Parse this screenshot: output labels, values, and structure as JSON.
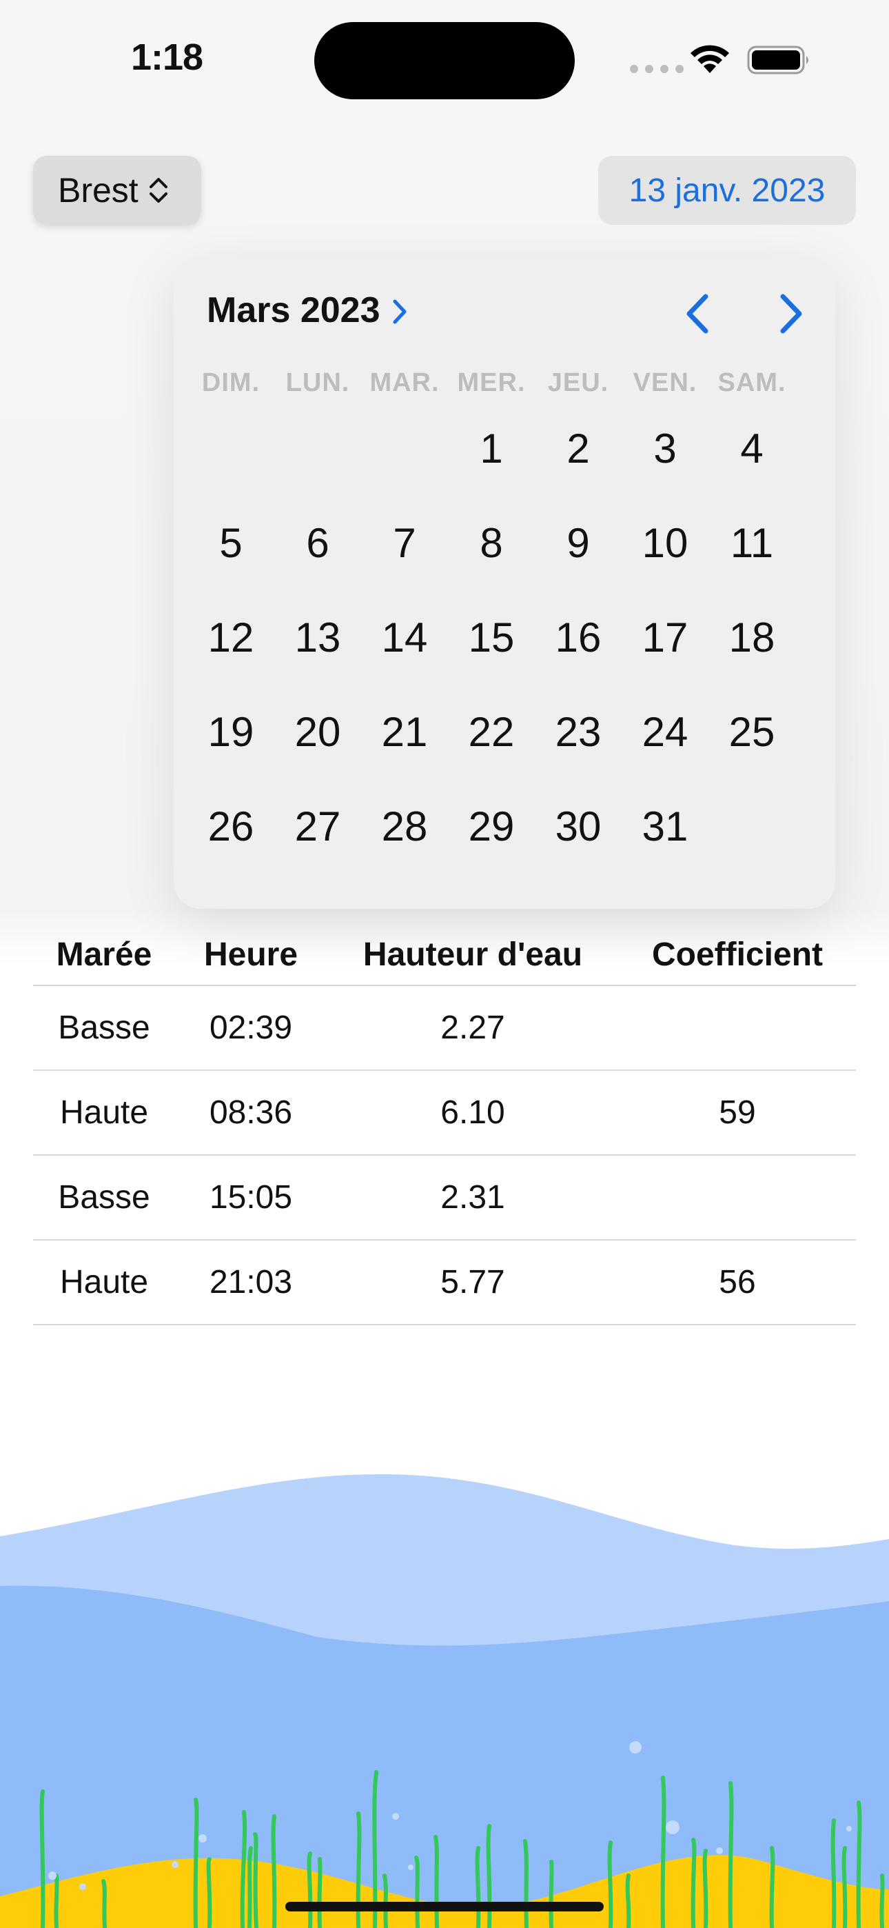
{
  "status_bar": {
    "time": "1:18"
  },
  "toolbar": {
    "city": "Brest",
    "date": "13 janv. 2023"
  },
  "calendar": {
    "month_label": "Mars 2023",
    "weekdays": [
      "DIM.",
      "LUN.",
      "MAR.",
      "MER.",
      "JEU.",
      "VEN.",
      "SAM."
    ],
    "leading_blank_days": 3,
    "days_in_month": 31
  },
  "tide_table": {
    "headers": [
      "Marée",
      "Heure",
      "Hauteur d'eau",
      "Coefficient"
    ],
    "rows": [
      {
        "tide": "Basse",
        "time": "02:39",
        "height": "2.27",
        "coefficient": ""
      },
      {
        "tide": "Haute",
        "time": "08:36",
        "height": "6.10",
        "coefficient": "59"
      },
      {
        "tide": "Basse",
        "time": "15:05",
        "height": "2.31",
        "coefficient": ""
      },
      {
        "tide": "Haute",
        "time": "21:03",
        "height": "5.77",
        "coefficient": "56"
      }
    ]
  },
  "colors": {
    "accent": "#1a6fe0",
    "wave_light": "#b7d3fb",
    "wave_mid": "#8fbcf8",
    "sand": "#ffcc0a",
    "seaweed": "#34c759"
  },
  "icons": {
    "city_chevron": "chevron-up-down-icon",
    "month_chevron": "chevron-right-icon",
    "prev_month": "chevron-left-icon",
    "next_month": "chevron-right-icon",
    "wifi": "wifi-icon",
    "battery": "battery-icon"
  }
}
